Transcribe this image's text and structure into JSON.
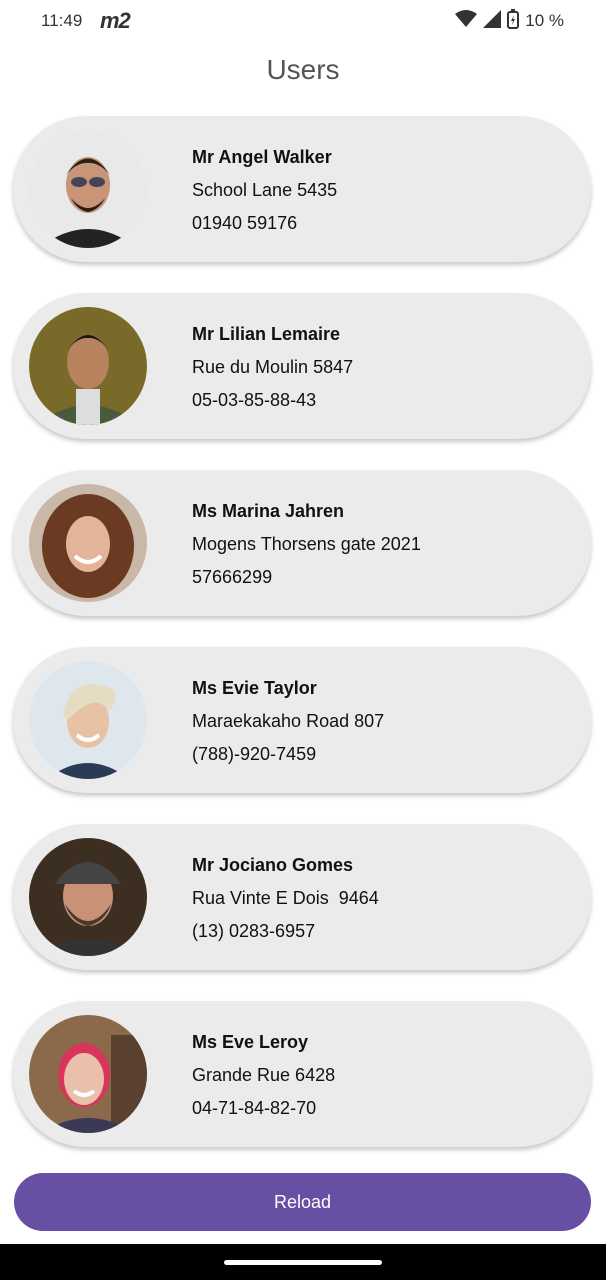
{
  "status_bar": {
    "time": "11:49",
    "carrier": "т2",
    "battery": "10 %",
    "icons": [
      "wifi-icon",
      "signal-icon",
      "battery-charging-icon"
    ]
  },
  "header": {
    "title": "Users"
  },
  "users": [
    {
      "name": "Mr Angel Walker",
      "address": "School Lane 5435",
      "phone": "01940 59176",
      "avatar_bg": "#e9e9e9",
      "skin": "#c89677",
      "hair": "#2a1e18"
    },
    {
      "name": "Mr Lilian Lemaire",
      "address": "Rue du Moulin 5847",
      "phone": "05-03-85-88-43",
      "avatar_bg": "#7a6a2a",
      "skin": "#b8825f",
      "hair": "#1a1410"
    },
    {
      "name": "Ms Marina Jahren",
      "address": "Mogens Thorsens gate 2021",
      "phone": "57666299",
      "avatar_bg": "#c9b7a8",
      "skin": "#e3b49a",
      "hair": "#6b3a22"
    },
    {
      "name": "Ms Evie Taylor",
      "address": "Maraekakaho Road 807",
      "phone": "(788)-920-7459",
      "avatar_bg": "#dfe7ee",
      "skin": "#e8c2a4",
      "hair": "#e6dcc4"
    },
    {
      "name": "Mr Jociano Gomes",
      "address": "Rua Vinte E Dois  9464",
      "phone": "(13) 0283-6957",
      "avatar_bg": "#3d2e22",
      "skin": "#c99277",
      "hair": "#4a3a2c"
    },
    {
      "name": "Ms Eve Leroy",
      "address": "Grande Rue 6428",
      "phone": "04-71-84-82-70",
      "avatar_bg": "#8a6a4a",
      "skin": "#eac0ac",
      "hair": "#d8355a"
    }
  ],
  "reload_label": "Reload",
  "colors": {
    "accent": "#6750a4",
    "card": "#ebebeb"
  }
}
